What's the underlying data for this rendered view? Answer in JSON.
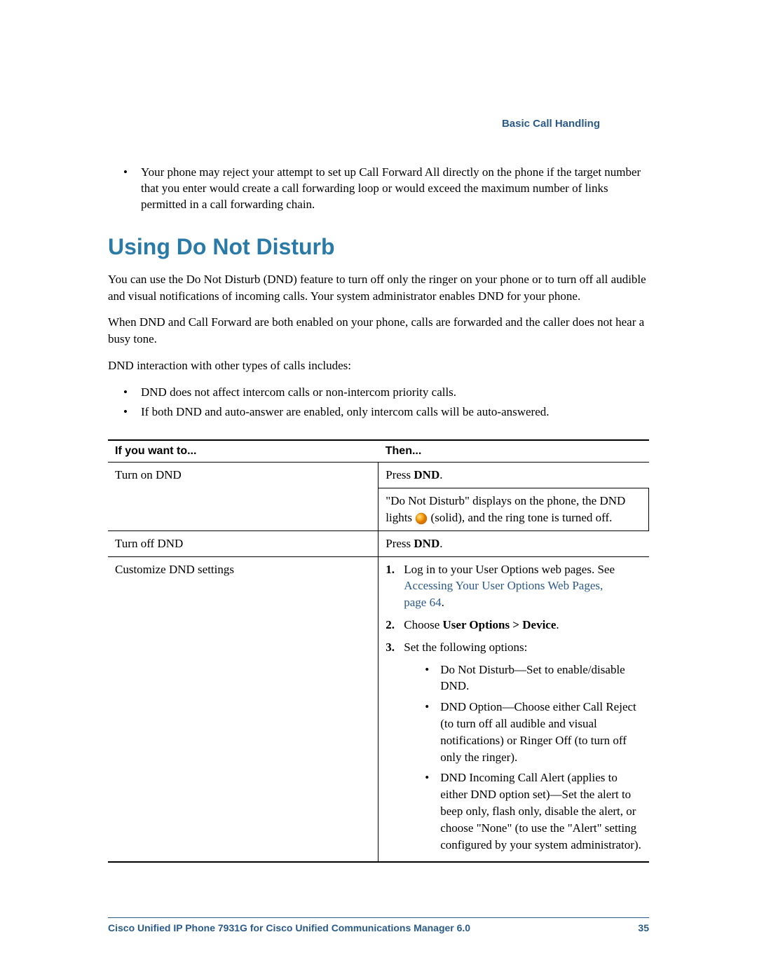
{
  "header": {
    "section_label": "Basic Call Handling"
  },
  "intro_bullet": "Your phone may reject your attempt to set up Call Forward All directly on the phone if the target number that you enter would create a call forwarding loop or would exceed the maximum number of links permitted in a call forwarding chain.",
  "heading": "Using Do Not Disturb",
  "paragraphs": {
    "p1": "You can use the Do Not Disturb (DND) feature to turn off only the ringer on your phone or to turn off all audible and visual notifications of incoming calls. Your system administrator enables DND for your phone.",
    "p2": "When DND and Call Forward are both enabled on your phone, calls are forwarded and the caller does not hear a busy tone.",
    "p3": "DND interaction with other types of calls includes:"
  },
  "bullets": {
    "b1": "DND does not affect intercom calls or non-intercom priority calls.",
    "b2": "If both DND and auto-answer are enabled, only intercom calls will be auto-answered."
  },
  "table": {
    "col1": "If you want to...",
    "col2": "Then...",
    "row1": {
      "want": "Turn on DND",
      "then_a_prefix": "Press ",
      "then_a_bold": "DND",
      "then_a_suffix": ".",
      "then_b_prefix": "\"Do Not Disturb\" displays on the phone, the DND lights ",
      "then_b_suffix": " (solid), and the ring tone is turned off."
    },
    "row2": {
      "want": "Turn off DND",
      "then_prefix": "Press ",
      "then_bold": "DND",
      "then_suffix": "."
    },
    "row3": {
      "want": "Customize DND settings",
      "step1_prefix": "Log in to your User Options web pages. See ",
      "step1_link": "Accessing Your User Options Web Pages, page 64",
      "step1_suffix": ".",
      "step2_prefix": "Choose ",
      "step2_bold": "User Options > Device",
      "step2_suffix": ".",
      "step3": "Set the following options:",
      "sub1": "Do Not Disturb—Set to enable/disable DND.",
      "sub2": "DND Option—Choose either Call Reject (to turn off all audible and visual notifications) or Ringer Off (to turn off only the ringer).",
      "sub3": "DND Incoming Call Alert (applies to either DND option set)—Set the alert to beep only, flash only, disable the alert, or choose \"None\" (to use the \"Alert\" setting configured by your system administrator)."
    }
  },
  "footer": {
    "title": "Cisco Unified IP Phone 7931G for Cisco Unified Communications Manager 6.0",
    "page": "35"
  }
}
